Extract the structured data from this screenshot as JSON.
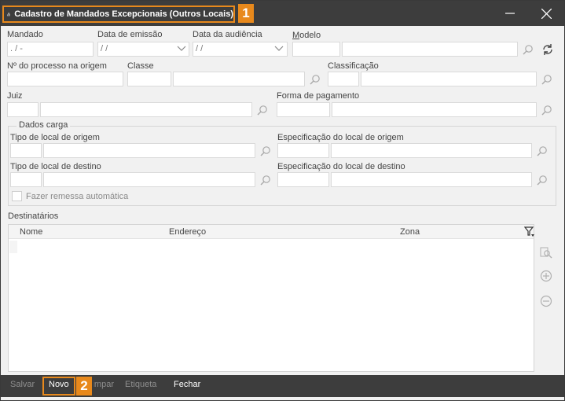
{
  "window": {
    "title": "Cadastro de Mandados Excepcionais (Outros Locais)",
    "badge_title": "1",
    "badge_novo": "2",
    "accent_color": "#e8891c",
    "titlebar_color": "#3d3d3d"
  },
  "labels": {
    "mandado": "Mandado",
    "data_emissao": "Data de emissão",
    "data_audiencia": "Data da audiência",
    "modelo": "Modelo",
    "processo_origem": "Nº do processo na origem",
    "classe": "Classe",
    "classificacao": "Classificação",
    "juiz": "Juiz",
    "forma_pagamento": "Forma de pagamento",
    "dados_carga": "Dados carga",
    "tipo_local_origem": "Tipo de local de origem",
    "espec_local_origem": "Especificação do local de origem",
    "tipo_local_destino": "Tipo de local de destino",
    "espec_local_destino": "Especificação do local de destino",
    "fazer_remessa": "Fazer remessa automática",
    "destinatarios": "Destinatários"
  },
  "values": {
    "mandado": "  .  /     -",
    "data_emissao": " / /",
    "data_audiencia": " / /"
  },
  "grid": {
    "columns": [
      "Nome",
      "Endereço",
      "Zona"
    ]
  },
  "bottom_bar": {
    "salvar": "Salvar",
    "novo": "Novo",
    "limpar": "Limpar",
    "etiqueta": "Etiqueta",
    "fechar": "Fechar"
  },
  "icons": [
    "app-logo-icon",
    "minimize-icon",
    "close-icon",
    "search-icon",
    "chevron-down-icon",
    "refresh-icon",
    "filter-icon",
    "zoom-icon",
    "add-circle-icon",
    "remove-circle-icon"
  ]
}
